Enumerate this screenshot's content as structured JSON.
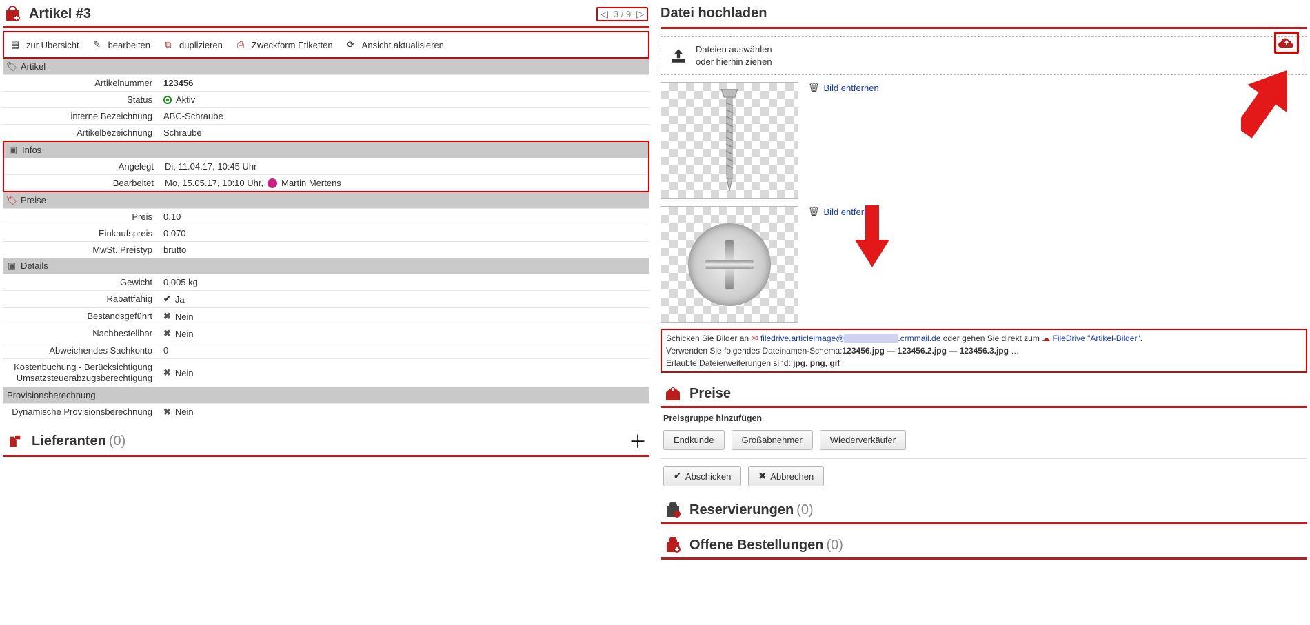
{
  "header": {
    "title": "Artikel #3",
    "pager": {
      "pos": "3 / 9"
    }
  },
  "toolbar": {
    "overview": "zur Übersicht",
    "edit": "bearbeiten",
    "duplicate": "duplizieren",
    "labels": "Zweckform Etiketten",
    "refresh": "Ansicht aktualisieren"
  },
  "sections": {
    "artikel": "Artikel",
    "infos": "Infos",
    "preise": "Preise",
    "details": "Details",
    "provisions": "Provisionsberechnung"
  },
  "artikel": {
    "artikelnummer_k": "Artikelnummer",
    "artikelnummer_v": "123456",
    "status_k": "Status",
    "status_v": "Aktiv",
    "intern_k": "interne Bezeichnung",
    "intern_v": "ABC-Schraube",
    "bez_k": "Artikelbezeichnung",
    "bez_v": "Schraube"
  },
  "infos": {
    "angelegt_k": "Angelegt",
    "angelegt_v": "Di, 11.04.17, 10:45 Uhr",
    "bearbeitet_k": "Bearbeitet",
    "bearbeitet_v": "Mo, 15.05.17, 10:10 Uhr,",
    "bearbeitet_user": "Martin Mertens"
  },
  "preise": {
    "preis_k": "Preis",
    "preis_v": "0,10",
    "ek_k": "Einkaufspreis",
    "ek_v": "0.070",
    "mwst_k": "MwSt. Preistyp",
    "mwst_v": "brutto"
  },
  "details": {
    "gewicht_k": "Gewicht",
    "gewicht_v": "0,005 kg",
    "rabatt_k": "Rabattfähig",
    "rabatt_v": "Ja",
    "bestand_k": "Bestandsgeführt",
    "bestand_v": "Nein",
    "nach_k": "Nachbestellbar",
    "nach_v": "Nein",
    "sach_k": "Abweichendes Sachkonto",
    "sach_v": "0",
    "kost_k": "Kostenbuchung - Berücksichtigung Umsatzsteuerabzugsberechtigung",
    "kost_v": "Nein"
  },
  "provisions": {
    "dyn_k": "Dynamische Provisionsberechnung",
    "dyn_v": "Nein"
  },
  "suppliers": {
    "title": "Lieferanten",
    "count": "(0)"
  },
  "upload": {
    "title": "Datei hochladen",
    "choose1": "Dateien auswählen",
    "choose2": "oder hierhin ziehen",
    "remove": "Bild entfernen",
    "hint_pre": "Schicken Sie Bilder an ",
    "hint_email": "filedrive.articleimage@",
    "hint_domain": ".crmmail.de",
    "hint_mid": " oder gehen Sie direkt zum ",
    "hint_fd": "FileDrive \"Artikel-Bilder\"",
    "hint_schema_pre": "Verwenden Sie folgendes Dateinamen-Schema:",
    "hint_schema": "123456.jpg — 123456.2.jpg — 123456.3.jpg",
    "hint_ellipsis": " …",
    "hint_ext_pre": "Erlaubte Dateierweiterungen sind: ",
    "hint_ext": "jpg, png, gif"
  },
  "prices_section": {
    "title": "Preise",
    "sub": "Preisgruppe hinzufügen",
    "b1": "Endkunde",
    "b2": "Großabnehmer",
    "b3": "Wiederverkäufer",
    "submit": "Abschicken",
    "cancel": "Abbrechen"
  },
  "reserv": {
    "title": "Reservierungen",
    "count": "(0)"
  },
  "orders": {
    "title": "Offene Bestellungen",
    "count": "(0)"
  }
}
